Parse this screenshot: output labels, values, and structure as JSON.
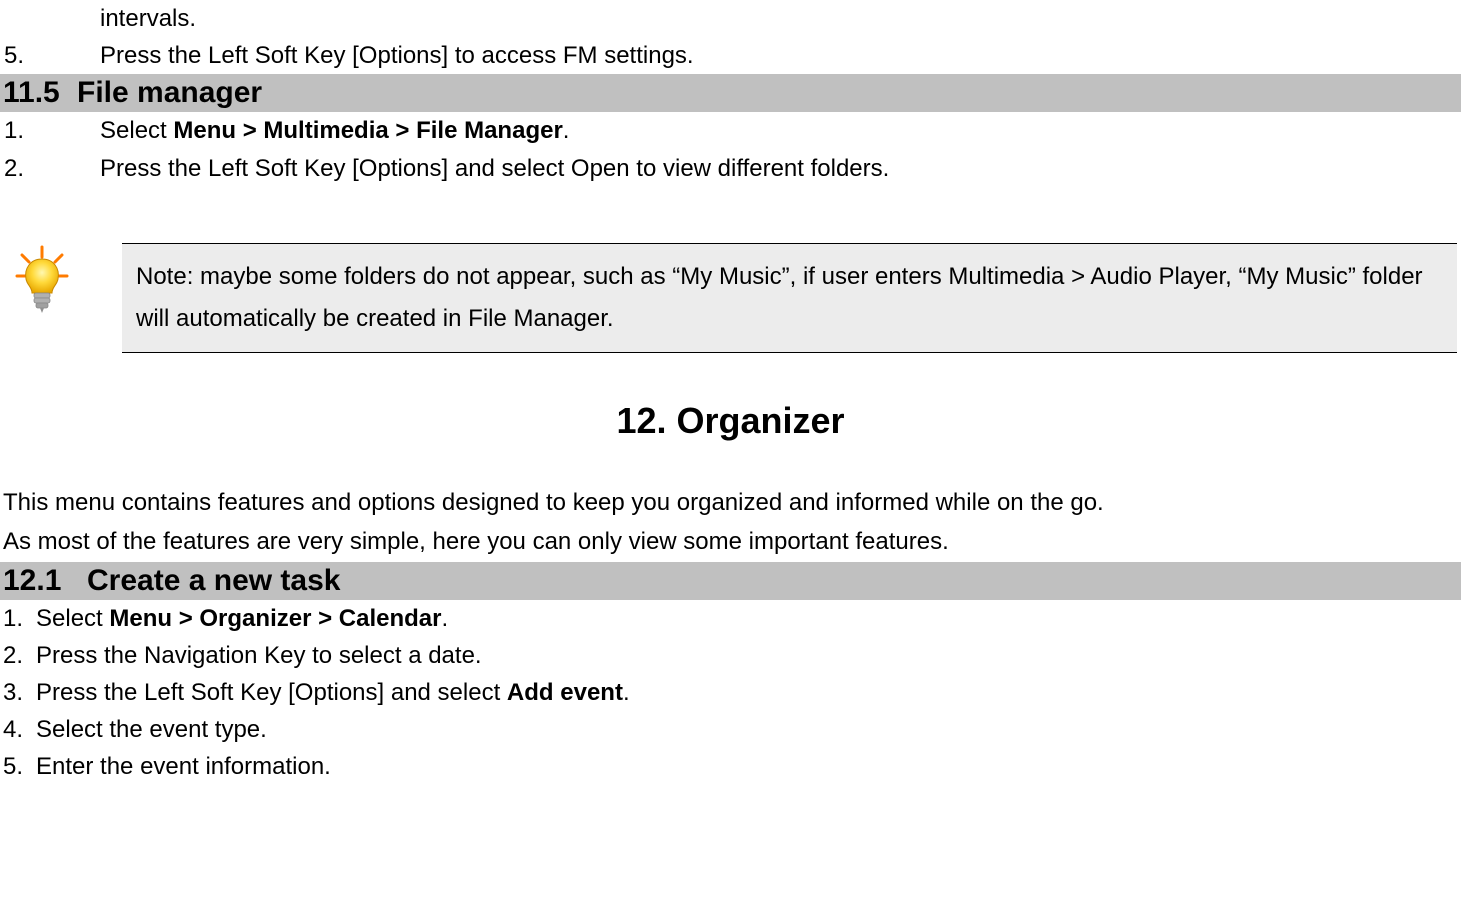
{
  "frag_top": "intervals.",
  "outer_list": {
    "item5_num": "5.",
    "item5_text": "Press the Left Soft Key [Options] to access FM settings."
  },
  "section_11_5": {
    "num": "11.5",
    "title": "File manager"
  },
  "sec11_5_list": {
    "item1_num": "1.",
    "item1_prefix": "Select ",
    "item1_bold": "Menu > Multimedia > File Manager",
    "item1_suffix": ".",
    "item2_num": "2.",
    "item2_text": "Press the Left Soft Key [Options] and select Open to view different folders."
  },
  "note_text": "Note: maybe some folders do not appear, such as “My Music”, if user enters Multimedia > Audio Player, “My Music” folder will automatically be created in File Manager.",
  "chapter_12": "12. Organizer",
  "chapter_12_intro1": "This menu contains features and options designed to keep you organized and informed while on the go.",
  "chapter_12_intro2": "As most of the features are very simple, here you can only view some important features.",
  "section_12_1": {
    "num": "12.1",
    "title": "Create a new task"
  },
  "sec12_1_list": {
    "item1_num": "1.",
    "item1_prefix": "Select ",
    "item1_bold": "Menu > Organizer > Calendar",
    "item1_suffix": ".",
    "item2_num": "2.",
    "item2_text": "Press the Navigation Key to select a date.",
    "item3_num": "3.",
    "item3_prefix": "Press the Left Soft Key [Options] and select ",
    "item3_bold": "Add event",
    "item3_suffix": ".",
    "item4_num": "4.",
    "item4_text": "Select the event type.",
    "item5_num": "5.",
    "item5_text": "Enter the event information."
  }
}
